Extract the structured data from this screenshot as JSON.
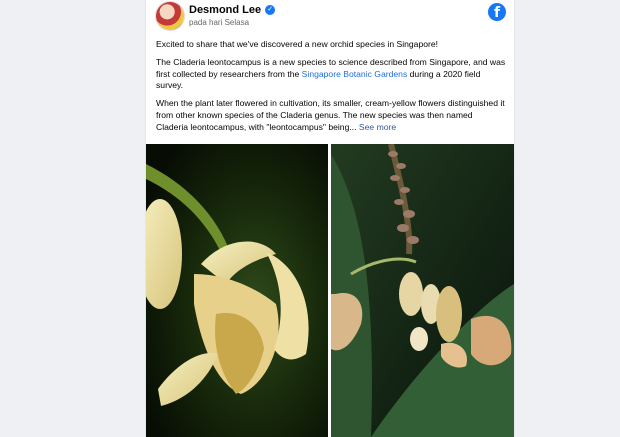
{
  "post": {
    "author": "Desmond Lee",
    "time": "pada hari Selasa",
    "paragraph1": "Excited to share that we've discovered a new orchid species in Singapore!",
    "paragraph2_a": "The Claderia leontocampus is a new species to science described from Singapore, and was first collected by researchers from the ",
    "paragraph2_link": "Singapore Botanic Gardens",
    "paragraph2_b": " during a 2020 field survey.",
    "paragraph3": "When the plant later flowered in cultivation, its smaller, cream-yellow flowers distinguished it from other known species of the Claderia genus. The new species was then named Claderia leontocampus, with \"leontocampus\" being... ",
    "see_more": "See more"
  },
  "icons": {
    "verified": "verified-check-icon",
    "brand": "facebook-logo-icon"
  },
  "colors": {
    "accent": "#1877f2",
    "link": "#216fdb",
    "background": "#eef0f3"
  }
}
